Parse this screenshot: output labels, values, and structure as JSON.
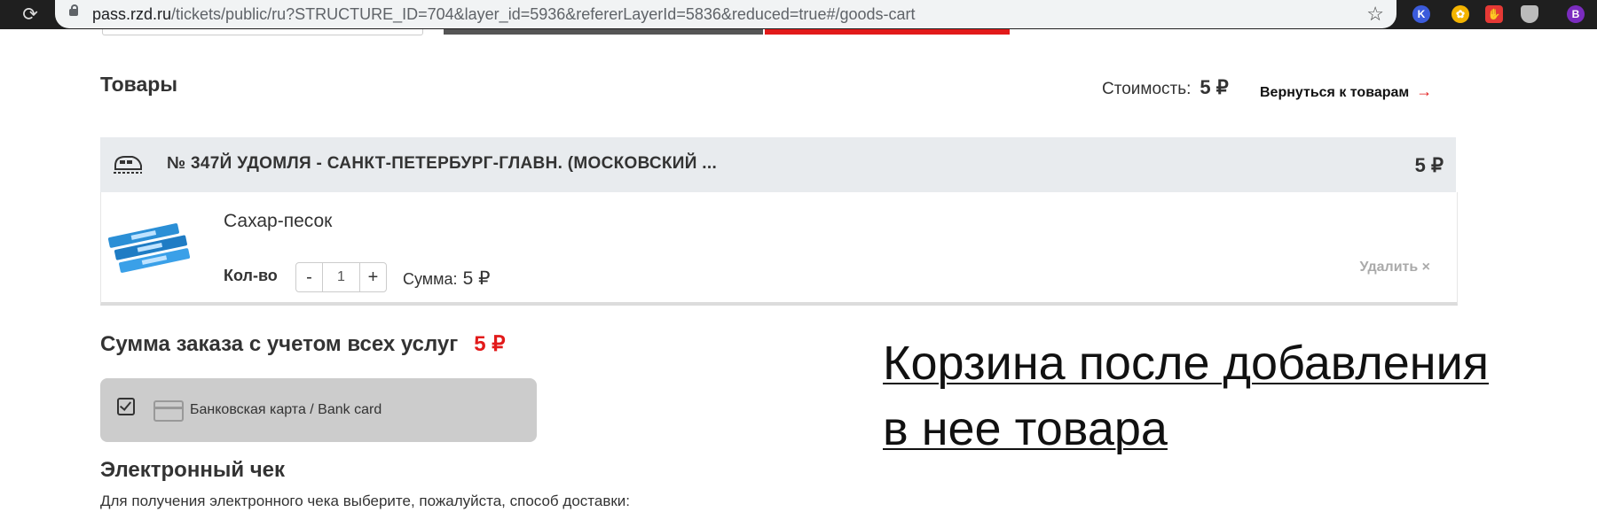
{
  "browser": {
    "url_host": "pass.rzd.ru",
    "url_rest": "/tickets/public/ru?STRUCTURE_ID=704&layer_id=5936&refererLayerId=5836&reduced=true#/goods-cart",
    "extension_profile_letter": "B",
    "extension_k_letter": "K"
  },
  "cart": {
    "title": "Товары",
    "cost_label": "Стоимость:",
    "cost_value": "5 ₽",
    "back_link": "Вернуться к товарам",
    "back_arrow": "→"
  },
  "train": {
    "name": "№ 347Й  УДОМЛЯ - САНКТ-ПЕТЕРБУРГ-ГЛАВН. (МОСКОВСКИЙ ...",
    "price": "5 ₽"
  },
  "item": {
    "name": "Сахар-песок",
    "qty_label": "Кол-во",
    "minus": "-",
    "quantity": "1",
    "plus": "+",
    "sum_label": "Сумма:",
    "sum_value": "5 ₽",
    "delete_label": "Удалить ×"
  },
  "order": {
    "total_label": "Сумма заказа с учетом всех услуг",
    "total_value": "5 ₽"
  },
  "payment": {
    "method_label": "Банковская карта / Bank card"
  },
  "receipt": {
    "title": "Электронный чек",
    "text": "Для получения электронного чека выберите, пожалуйста, способ доставки:"
  },
  "annotation": {
    "line1": "Корзина после добавления",
    "line2": "в нее товара"
  },
  "colors": {
    "accent_red": "#e21a1a",
    "header_bg": "#e8ebee",
    "payment_bg": "#cccccc"
  }
}
